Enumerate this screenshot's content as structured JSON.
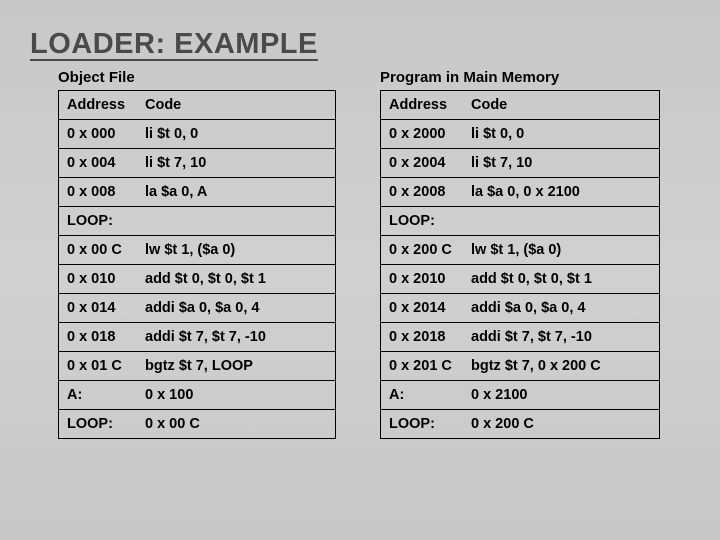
{
  "title": "LOADER: EXAMPLE",
  "left": {
    "heading": "Object File",
    "header_addr": "Address",
    "header_code": "Code",
    "rows": [
      {
        "addr": "0 x 000",
        "code": "li   $t 0, 0"
      },
      {
        "addr": "0 x 004",
        "code": "li   $t 7, 10"
      },
      {
        "addr": "0 x 008",
        "code": "la $a 0, A"
      },
      {
        "addr": "LOOP:",
        "code": ""
      },
      {
        "addr": "0 x 00 C",
        "code": "lw $t 1, ($a 0)"
      },
      {
        "addr": "0 x 010",
        "code": "add $t 0, $t 0, $t 1"
      },
      {
        "addr": "0 x 014",
        "code": "addi $a 0, $a 0, 4"
      },
      {
        "addr": "0 x 018",
        "code": "addi $t 7, $t 7, -10"
      },
      {
        "addr": "0 x 01 C",
        "code": "bgtz $t 7, LOOP"
      },
      {
        "addr": "A:",
        "code": "0 x 100"
      },
      {
        "addr": "LOOP:",
        "code": "0 x 00 C"
      }
    ]
  },
  "right": {
    "heading": "Program in Main Memory",
    "header_addr": "Address",
    "header_code": "Code",
    "rows": [
      {
        "addr": "0 x 2000",
        "code": "li   $t 0, 0"
      },
      {
        "addr": "0 x 2004",
        "code": "li   $t 7, 10"
      },
      {
        "addr": "0 x 2008",
        "code": "la $a 0, 0 x 2100"
      },
      {
        "addr": "LOOP:",
        "code": ""
      },
      {
        "addr": "0 x 200 C",
        "code": "lw $t 1, ($a 0)"
      },
      {
        "addr": "0 x 2010",
        "code": "add $t 0, $t 0, $t 1"
      },
      {
        "addr": "0 x 2014",
        "code": "addi $a 0, $a 0, 4"
      },
      {
        "addr": "0 x 2018",
        "code": "addi $t 7, $t 7, -10"
      },
      {
        "addr": "0 x 201 C",
        "code": "bgtz $t 7, 0 x 200 C"
      },
      {
        "addr": "A:",
        "code": "0 x 2100"
      },
      {
        "addr": "LOOP:",
        "code": "0 x 200 C"
      }
    ]
  }
}
